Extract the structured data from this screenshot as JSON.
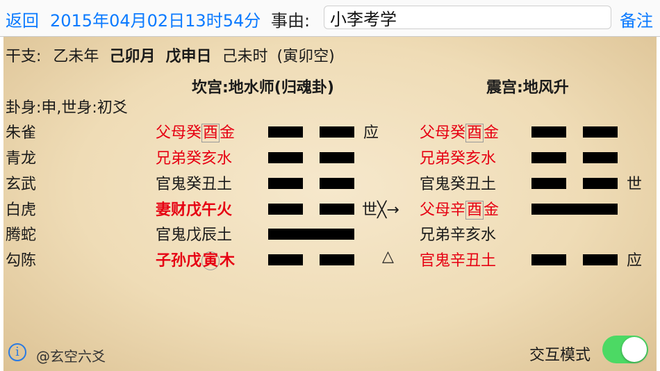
{
  "topbar": {
    "back_label": "返回",
    "datetime": "2015年04月02日13时54分",
    "reason_label": "事由:",
    "reason_value": "小李考学",
    "note_label": "备注"
  },
  "ganzhi": {
    "label": "干支:",
    "year": "乙未年",
    "month": "己卯月",
    "day": "戊申日",
    "hour": "己未时",
    "void": "(寅卯空)"
  },
  "headings": {
    "main": "坎宫:地水师(归魂卦)",
    "changed": "震宫:地风升"
  },
  "gua_shen": "卦身:申,世身:初爻",
  "rows": [
    {
      "god": "朱雀",
      "main_pre": "父母癸",
      "main_mark": "酉",
      "main_post": "金",
      "mark": "应",
      "changed_pre": "父母癸",
      "changed_mark": "酉",
      "changed_post": "金",
      "changed_mark2": ""
    },
    {
      "god": "青龙",
      "main": "兄弟癸亥水",
      "mark": "",
      "changed": "兄弟癸亥水",
      "changed_mark2": ""
    },
    {
      "god": "玄武",
      "main": "官鬼癸丑土",
      "mark": "",
      "changed": "官鬼癸丑土",
      "changed_mark2": "世"
    },
    {
      "god": "白虎",
      "main": "妻财戊午火",
      "mark": "世╳→",
      "changed_pre": "父母辛",
      "changed_mark": "酉",
      "changed_post": "金",
      "changed_mark2": ""
    },
    {
      "god": "腾蛇",
      "main": "官鬼戊辰土",
      "mark": "",
      "changed": "兄弟辛亥水",
      "changed_mark2": ""
    },
    {
      "god": "勾陈",
      "main_pre": "子孙戊",
      "main_mark": "寅",
      "main_post": "木",
      "mark": "△",
      "changed": "官鬼辛丑土",
      "changed_mark2": "应"
    }
  ],
  "yao_main": [
    "yin",
    "yin",
    "yin",
    "yin",
    "yang",
    "yin"
  ],
  "yao_changed": [
    "yin",
    "yin",
    "yin",
    "yang",
    "none",
    "yin"
  ],
  "footer": {
    "info_icon": "i",
    "credit": "@玄空六爻",
    "interactive_label": "交互模式",
    "interactive_on": true
  },
  "colors": {
    "accent": "#0a7aff",
    "red": "#e60012",
    "toggle": "#4cd964"
  }
}
